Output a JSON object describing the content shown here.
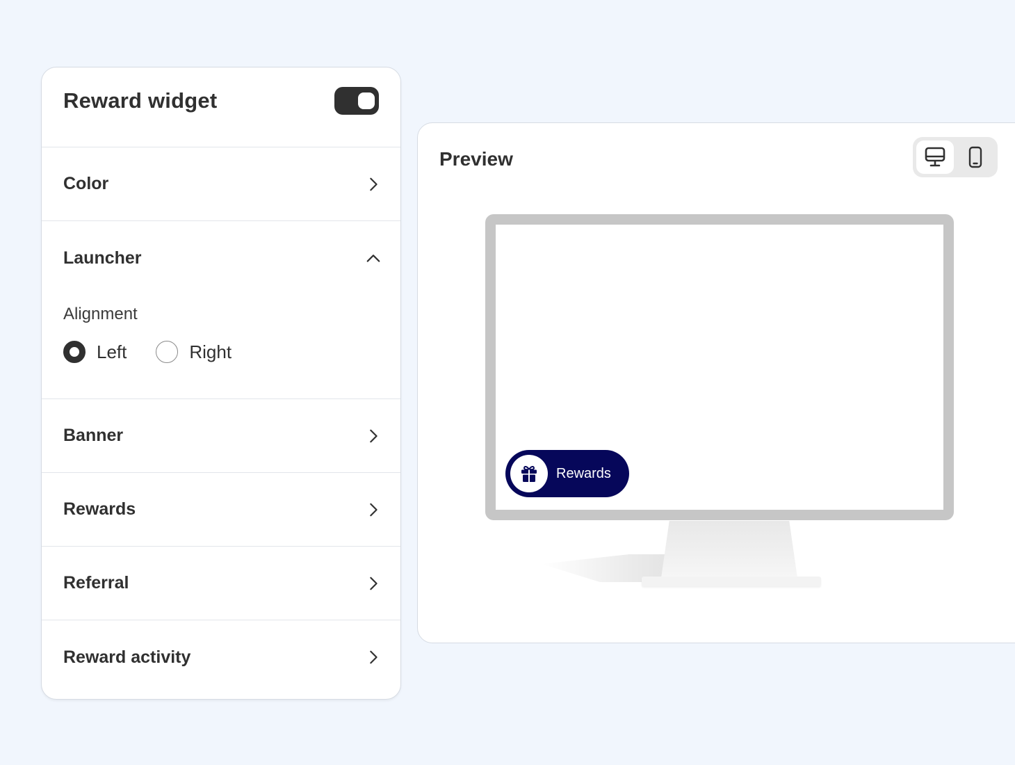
{
  "settings": {
    "title": "Reward widget",
    "enabled": true,
    "sections": {
      "color": {
        "label": "Color"
      },
      "launcher": {
        "label": "Launcher",
        "alignment_label": "Alignment",
        "options": [
          {
            "label": "Left",
            "selected": true
          },
          {
            "label": "Right",
            "selected": false
          }
        ]
      },
      "banner": {
        "label": "Banner"
      },
      "rewards": {
        "label": "Rewards"
      },
      "referral": {
        "label": "Referral"
      },
      "reward_activity": {
        "label": "Reward activity"
      }
    }
  },
  "preview": {
    "title": "Preview",
    "device_modes": [
      "desktop-icon",
      "mobile-icon"
    ],
    "active_device": "desktop",
    "launcher_button": {
      "label": "Rewards",
      "icon": "gift-icon"
    }
  },
  "colors": {
    "background": "#f1f6fd",
    "text": "#303030",
    "launcher_bg": "#06075a",
    "monitor_bezel": "#c6c6c6"
  }
}
